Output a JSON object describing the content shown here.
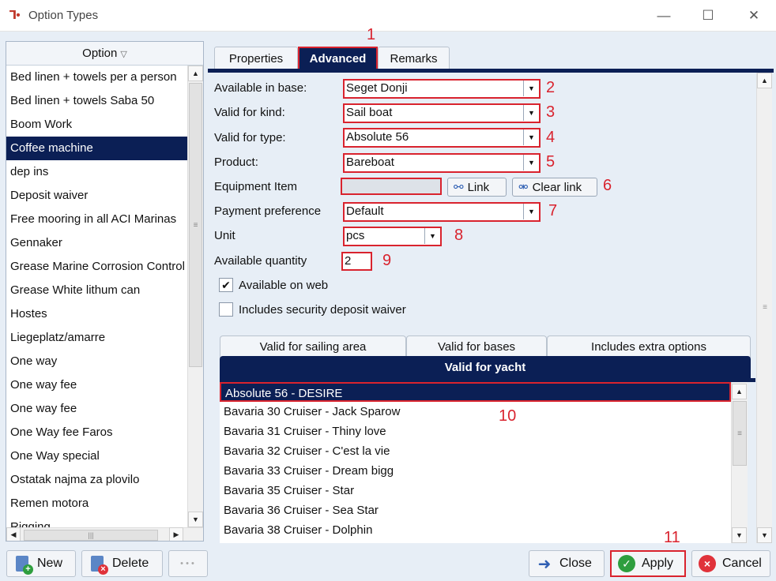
{
  "window": {
    "title": "Option Types",
    "app_icon": "app-logo-icon",
    "min_glyph": "—",
    "max_glyph": "☐",
    "close_glyph": "✕"
  },
  "list": {
    "header": "Option",
    "items": [
      "Bed linen + towels per a person",
      "Bed linen + towels Saba 50",
      "Boom Work",
      "Coffee machine",
      "dep ins",
      "Deposit waiver",
      "Free mooring in all ACI Marinas",
      "Gennaker",
      "Grease Marine Corrosion Control",
      "Grease  White lithum can",
      "Hostes",
      "Liegeplatz/amarre",
      "One way",
      "One way fee",
      "One way fee",
      "One Way fee Faros",
      "One Way special",
      "Ostatak najma za plovilo",
      "Remen motora",
      "Rigging"
    ],
    "selected_index": 3
  },
  "buttons": {
    "new": "New",
    "delete": "Delete",
    "more": "• • •",
    "close": "Close",
    "apply": "Apply",
    "cancel": "Cancel"
  },
  "tabs": [
    "Properties",
    "Advanced",
    "Remarks"
  ],
  "form": {
    "available_in_base": {
      "label": "Available in base:",
      "value": "Seget Donji"
    },
    "valid_for_kind": {
      "label": "Valid for kind:",
      "value": "Sail boat"
    },
    "valid_for_type": {
      "label": "Valid for type:",
      "value": "Absolute 56"
    },
    "product": {
      "label": "Product:",
      "value": "Bareboat"
    },
    "equipment_item": {
      "label": "Equipment Item",
      "value": "",
      "link": "Link",
      "clear_link": "Clear link"
    },
    "payment_preference": {
      "label": "Payment preference",
      "value": "Default"
    },
    "unit": {
      "label": "Unit",
      "value": "pcs"
    },
    "available_quantity": {
      "label": "Available quantity",
      "value": "2"
    },
    "available_on_web": {
      "label": "Available on web",
      "checked": true
    },
    "includes_security_deposit_waiver": {
      "label": "Includes security deposit waiver",
      "checked": false
    }
  },
  "inner_tabs": [
    "Valid for sailing area",
    "Valid for bases",
    "Includes extra options"
  ],
  "active_inner_tab": "Valid for yacht",
  "yachts": [
    "Absolute 56 - DESIRE",
    "Bavaria 30 Cruiser - Jack Sparow",
    "Bavaria 31 Cruiser - Thiny love",
    "Bavaria 32 Cruiser - C'est la vie",
    "Bavaria 33 Cruiser - Dream bigg",
    "Bavaria 35 Cruiser - Star",
    "Bavaria 36 Cruiser - Sea Star",
    "Bavaria 38 Cruiser - Dolphin"
  ],
  "annotations": [
    "1",
    "2",
    "3",
    "4",
    "5",
    "6",
    "7",
    "8",
    "9",
    "10",
    "11"
  ],
  "colors": {
    "accent": "#0b1f55",
    "highlight": "#d9232e",
    "apply_green": "#2e9e3e",
    "cancel_red": "#e0323a"
  }
}
